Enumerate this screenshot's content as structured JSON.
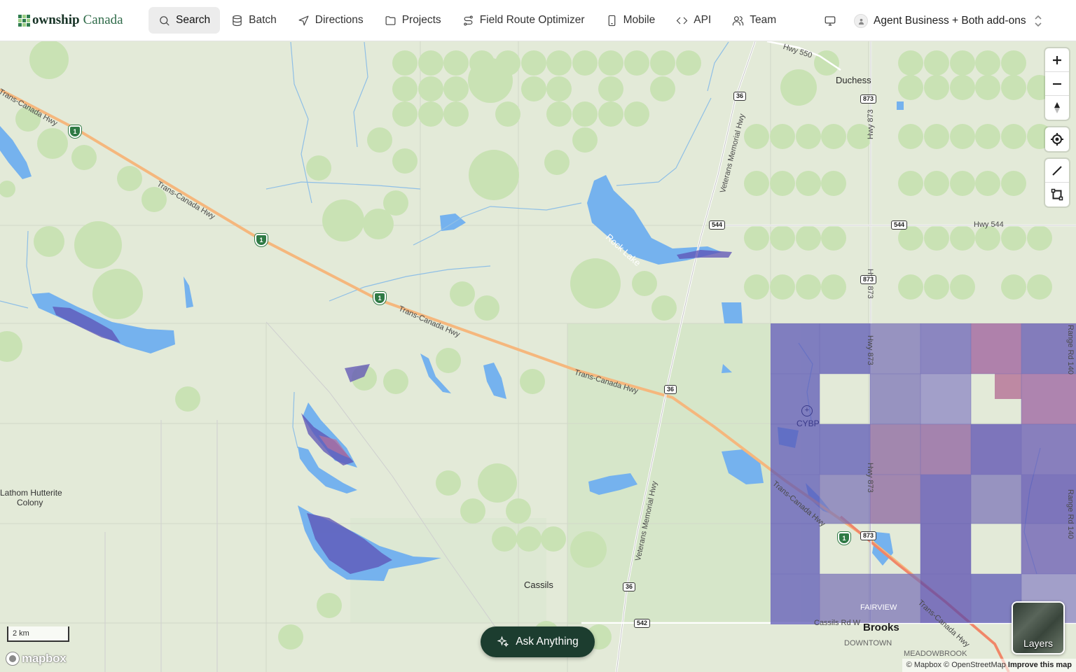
{
  "app": {
    "logo_main": "ownship",
    "logo_sub": "Canada"
  },
  "nav": [
    {
      "label": "Search",
      "icon": "search-icon",
      "active": true
    },
    {
      "label": "Batch",
      "icon": "database-icon"
    },
    {
      "label": "Directions",
      "icon": "navigation-arrow-icon"
    },
    {
      "label": "Projects",
      "icon": "folder-icon"
    },
    {
      "label": "Field Route Optimizer",
      "icon": "route-icon"
    },
    {
      "label": "Mobile",
      "icon": "smartphone-icon"
    },
    {
      "label": "API",
      "icon": "code-icon"
    },
    {
      "label": "Team",
      "icon": "users-icon"
    }
  ],
  "account": {
    "label": "Agent Business + Both add-ons",
    "icon": "user-icon"
  },
  "map": {
    "places": {
      "duchess": "Duchess",
      "rock_lake": "Rock Lake",
      "cassils": "Cassils",
      "brooks": "Brooks",
      "lathom": "Lathom Hutterite",
      "colony": "Colony",
      "airport": "CYBP",
      "fairview": "FAIRVIEW",
      "downtown": "DOWNTOWN",
      "meadowbrook": "MEADOWBROOK",
      "cassils_rd": "Cassils Rd W"
    },
    "roads": {
      "trans_canada": "Trans-Canada Hwy",
      "veterans": "Veterans Memorial Hwy",
      "hwy550": "Hwy 550",
      "hwy544": "Hwy 544",
      "hwy873": "Hwy 873",
      "range_rd": "Range Rd 140"
    },
    "shields": {
      "s36": "36",
      "s544": "544",
      "s873": "873",
      "s542": "542",
      "tch": "1"
    },
    "scale": "2 km",
    "mapbox": "mapbox",
    "attribution": {
      "mapbox": "© Mapbox",
      "osm": "© OpenStreetMap",
      "improve": "Improve this map"
    }
  },
  "ask": {
    "label": "Ask Anything"
  },
  "layers": {
    "label": "Layers"
  },
  "colors": {
    "accent": "#1c3d2f",
    "water": "#75b2ee",
    "overlay": "#5b4bb7"
  }
}
